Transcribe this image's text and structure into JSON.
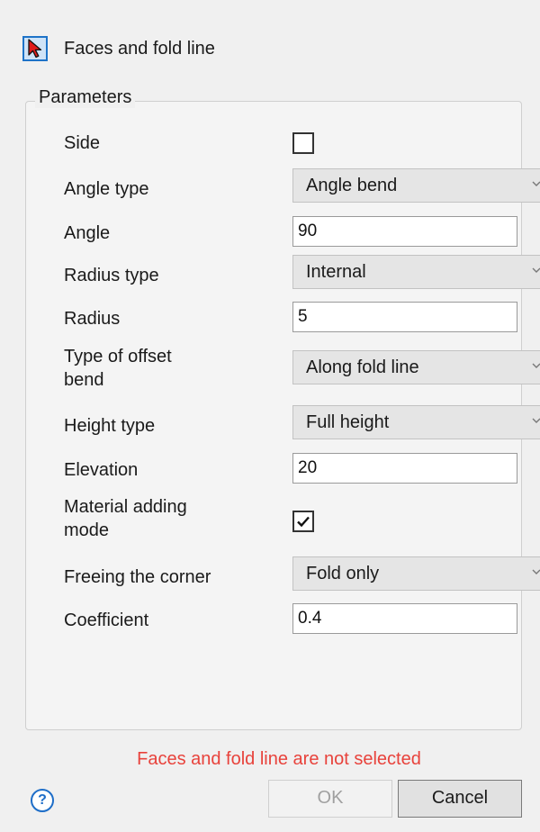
{
  "header": {
    "title": "Faces and fold line",
    "tool_icon": "red-arrow-pointer-icon"
  },
  "parameters": {
    "legend": "Parameters",
    "side": {
      "label": "Side",
      "checked": false
    },
    "angle_type": {
      "label": "Angle type",
      "value": "Angle bend"
    },
    "angle": {
      "label": "Angle",
      "value": "90"
    },
    "radius_type": {
      "label": "Radius type",
      "value": "Internal"
    },
    "radius": {
      "label": "Radius",
      "value": "5"
    },
    "offset_bend_type": {
      "label_line1": "Type of offset",
      "label_line2": "bend",
      "value": "Along fold line"
    },
    "height_type": {
      "label": "Height type",
      "value": "Full height"
    },
    "elevation": {
      "label": "Elevation",
      "value": "20"
    },
    "material_adding_mode": {
      "label_line1": "Material adding",
      "label_line2": "mode",
      "checked": true
    },
    "freeing_corner": {
      "label": "Freeing the corner",
      "value": "Fold only"
    },
    "coefficient": {
      "label": "Coefficient",
      "value": "0.4"
    }
  },
  "status": {
    "message": "Faces and fold line are not selected",
    "color": "#e8423b"
  },
  "footer": {
    "help_glyph": "?",
    "ok_label": "OK",
    "cancel_label": "Cancel",
    "ok_enabled": false
  },
  "colors": {
    "accent": "#1e73c8",
    "pointer": "#e01b1b"
  }
}
